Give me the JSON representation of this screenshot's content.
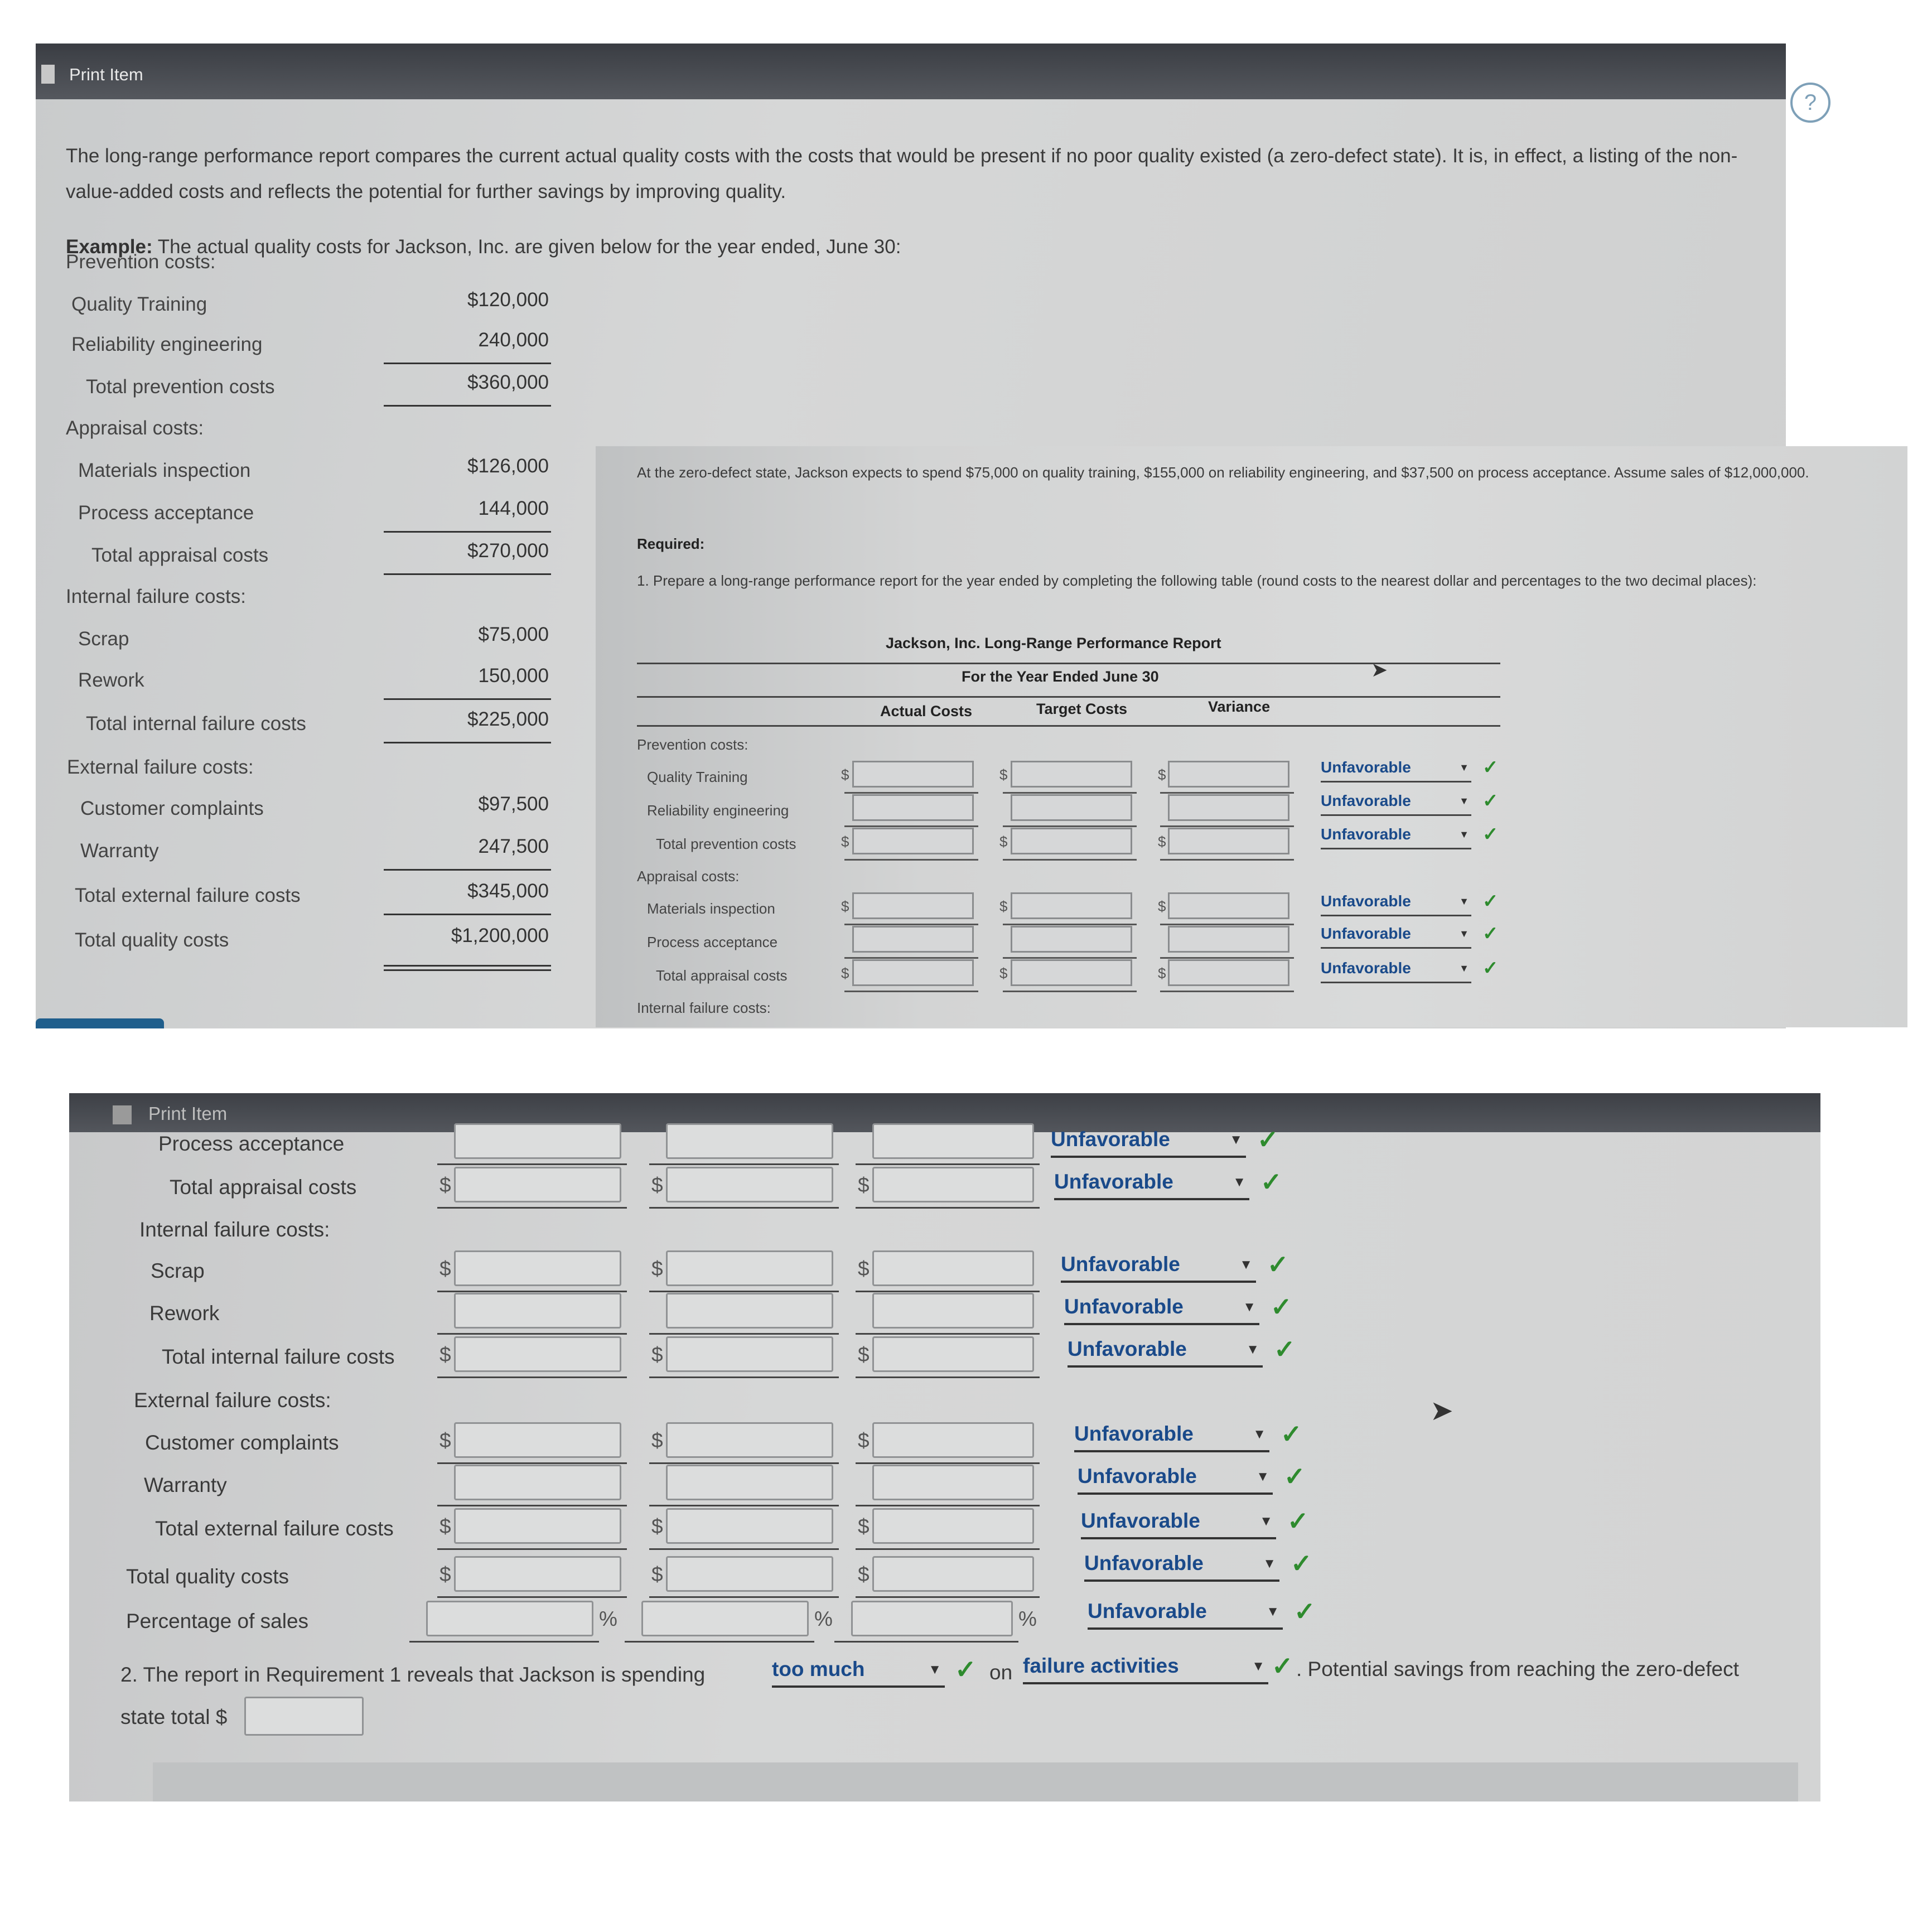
{
  "window": {
    "title": "Print Item"
  },
  "intro_text": "The long-range performance report compares the current actual quality costs with the costs that would be present if no poor quality existed (a zero-defect state). It is, in effect, a listing of the non-value-added costs and reflects the potential for further savings by improving quality.",
  "example": {
    "label": "Example:",
    "text": "The actual quality costs for Jackson, Inc. are given below for the year ended, June 30:",
    "rows": [
      {
        "label": "Prevention costs:",
        "value": ""
      },
      {
        "label": "Quality Training",
        "value": "$120,000"
      },
      {
        "label": "Reliability engineering",
        "value": "240,000"
      },
      {
        "label": "Total prevention costs",
        "value": "$360,000"
      },
      {
        "label": "Appraisal costs:",
        "value": ""
      },
      {
        "label": "Materials inspection",
        "value": "$126,000"
      },
      {
        "label": "Process acceptance",
        "value": "144,000"
      },
      {
        "label": "Total appraisal costs",
        "value": "$270,000"
      },
      {
        "label": "Internal failure costs:",
        "value": ""
      },
      {
        "label": "Scrap",
        "value": "$75,000"
      },
      {
        "label": "Rework",
        "value": "150,000"
      },
      {
        "label": "Total internal failure costs",
        "value": "$225,000"
      },
      {
        "label": "External failure costs:",
        "value": ""
      },
      {
        "label": "Customer complaints",
        "value": "$97,500"
      },
      {
        "label": "Warranty",
        "value": "247,500"
      },
      {
        "label": "Total external failure costs",
        "value": "$345,000"
      },
      {
        "label": "Total quality costs",
        "value": "$1,200,000"
      }
    ]
  },
  "scenario": {
    "text": "At the zero-defect state, Jackson expects to spend $75,000 on quality training, $155,000 on reliability engineering, and $37,500 on process acceptance. Assume sales of $12,000,000.",
    "required_label": "Required:",
    "req1": "1. Prepare a long-range performance report for the year ended by completing the following table (round costs to the nearest dollar and percentages to the two decimal places):"
  },
  "report": {
    "title": "Jackson, Inc. Long-Range Performance Report",
    "subtitle": "For the Year Ended June 30",
    "columns": [
      "Actual Costs",
      "Target Costs",
      "Variance"
    ],
    "currency": "$",
    "percent": "%",
    "variance_choice": "Unfavorable",
    "check": "✓",
    "top_rows": [
      {
        "label": "Prevention costs:"
      },
      {
        "label": "Quality Training"
      },
      {
        "label": "Reliability engineering"
      },
      {
        "label": "Total prevention costs"
      },
      {
        "label": "Appraisal costs:"
      },
      {
        "label": "Materials inspection"
      },
      {
        "label": "Process acceptance"
      },
      {
        "label": "Total appraisal costs"
      },
      {
        "label": "Internal failure costs:"
      }
    ],
    "bottom_rows": [
      {
        "label": "Process acceptance"
      },
      {
        "label": "Total appraisal costs"
      },
      {
        "label": "Internal failure costs:"
      },
      {
        "label": "Scrap"
      },
      {
        "label": "Rework"
      },
      {
        "label": "Total internal failure costs"
      },
      {
        "label": "External failure costs:"
      },
      {
        "label": "Customer complaints"
      },
      {
        "label": "Warranty"
      },
      {
        "label": "Total external failure costs"
      },
      {
        "label": "Total quality costs"
      },
      {
        "label": "Percentage of sales"
      }
    ]
  },
  "requirement2": {
    "prefix": "2. The report in Requirement 1 reveals that Jackson is spending",
    "choice1": "too much",
    "middle": "on",
    "choice2": "failure activities",
    "suffix": ". Potential savings from reaching the zero-defect",
    "line2": "state total $"
  },
  "icons": {
    "help": "help-icon",
    "cursor": "mouse-cursor-icon",
    "dropdown": "chevron-down-icon",
    "check": "check-icon"
  }
}
